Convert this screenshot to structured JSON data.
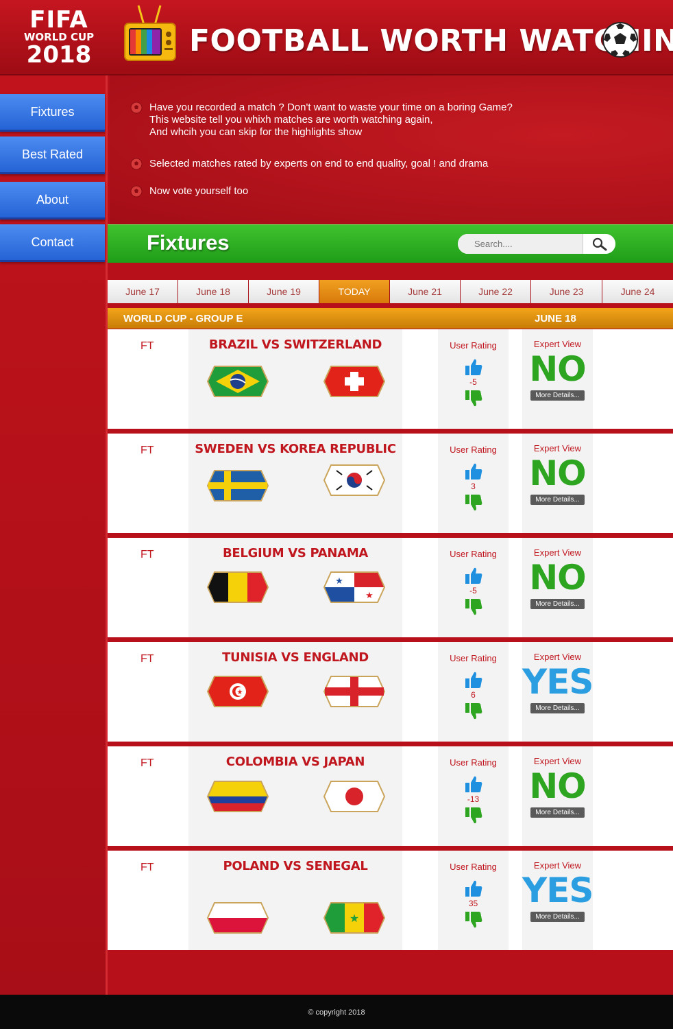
{
  "header": {
    "logo": {
      "line1": "FIFA",
      "line2": "WORLD CUP",
      "line3": "2018"
    },
    "title": "FOOTBALL WORTH WATCHING",
    "icons": [
      "tv-icon",
      "football-icon"
    ]
  },
  "sidebar": {
    "items": [
      {
        "label": "Fixtures"
      },
      {
        "label": "Best Rated"
      },
      {
        "label": "About"
      },
      {
        "label": "Contact"
      }
    ]
  },
  "intro": {
    "items": [
      {
        "lines": [
          "Have you recorded a match ? Don't want to waste your time on a boring Game?",
          "This website tell you whixh matches are worth watching again,",
          "And whcih you can skip for the highlights show"
        ]
      },
      {
        "lines": [
          "Selected matches rated by experts on end to end quality, goal ! and drama"
        ]
      },
      {
        "lines": [
          "Now vote yourself too"
        ]
      }
    ]
  },
  "fixtures": {
    "title": "Fixtures",
    "search_placeholder": "Search...."
  },
  "date_tabs": [
    {
      "label": "June 17",
      "active": false
    },
    {
      "label": "June 18",
      "active": false
    },
    {
      "label": "June 19",
      "active": false
    },
    {
      "label": "TODAY",
      "active": true
    },
    {
      "label": "June 21",
      "active": false
    },
    {
      "label": "June 22",
      "active": false
    },
    {
      "label": "June 23",
      "active": false
    },
    {
      "label": "June 24",
      "active": false
    }
  ],
  "group": {
    "name": "WORLD CUP - GROUP E",
    "date": "JUNE 18"
  },
  "labels": {
    "user_rating": "User Rating",
    "expert_view": "Expert View",
    "more_details": "More Details..."
  },
  "matches": [
    {
      "status": "FT",
      "title": "BRAZIL VS SWITZERLAND",
      "home_flag": "brazil-flag",
      "away_flag": "switzerland-flag",
      "rating": "-5",
      "verdict": "NO"
    },
    {
      "status": "FT",
      "title": "SWEDEN VS KOREA REPUBLIC",
      "home_flag": "sweden-flag",
      "away_flag": "korea-republic-flag",
      "rating": "3",
      "verdict": "NO"
    },
    {
      "status": "FT",
      "title": "BELGIUM VS PANAMA",
      "home_flag": "belgium-flag",
      "away_flag": "panama-flag",
      "rating": "-5",
      "verdict": "NO"
    },
    {
      "status": "FT",
      "title": "TUNISIA VS ENGLAND",
      "home_flag": "tunisia-flag",
      "away_flag": "england-flag",
      "rating": "6",
      "verdict": "YES"
    },
    {
      "status": "FT",
      "title": "COLOMBIA VS JAPAN",
      "home_flag": "colombia-flag",
      "away_flag": "japan-flag",
      "rating": "-13",
      "verdict": "NO"
    },
    {
      "status": "FT",
      "title": "POLAND VS SENEGAL",
      "home_flag": "poland-flag",
      "away_flag": "senegal-flag",
      "rating": "35",
      "verdict": "YES"
    }
  ],
  "colors": {
    "primary_red": "#c0171f",
    "nav_blue": "#2563d6",
    "green": "#2ea521",
    "yes_blue": "#2a9ee0",
    "orange": "#e08c10"
  },
  "footer": {
    "copyright": "© copyright 2018"
  }
}
